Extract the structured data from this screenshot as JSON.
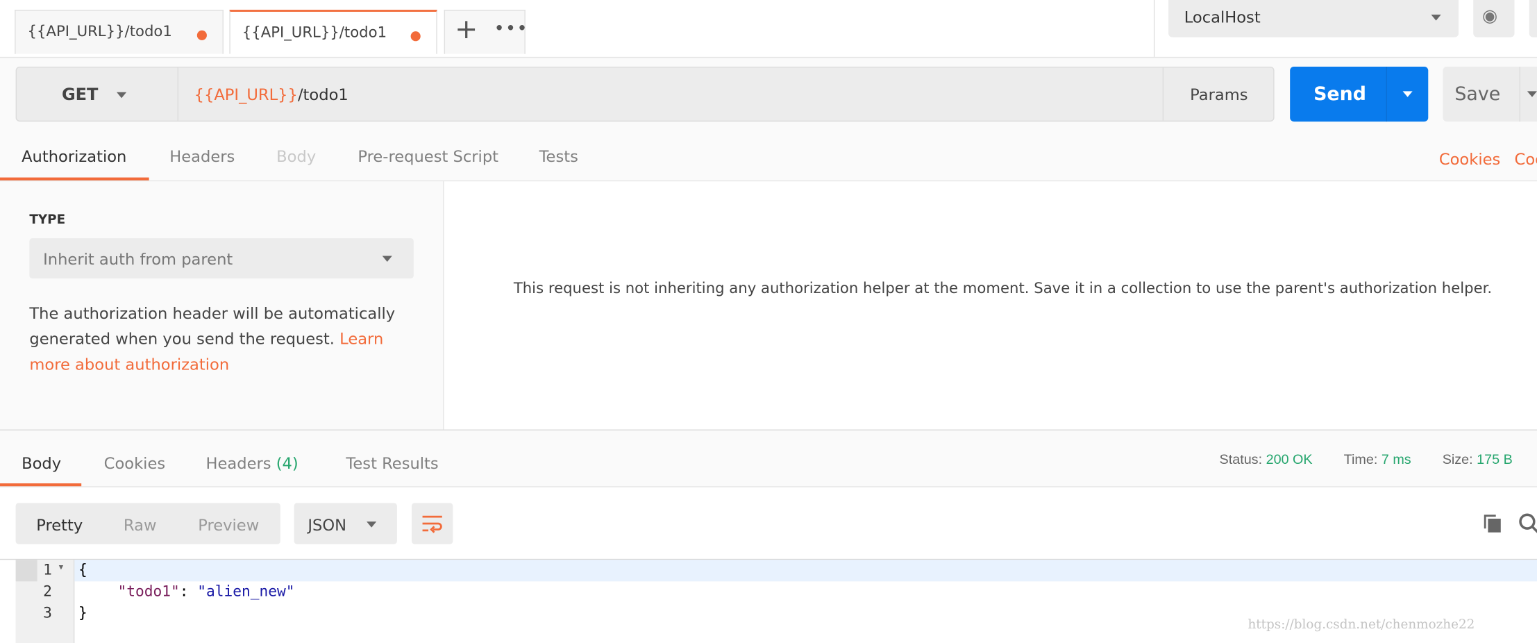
{
  "tabs": [
    {
      "label": "{{API_URL}}/todo1",
      "unsaved": true
    },
    {
      "label": "{{API_URL}}/todo1",
      "unsaved": true
    }
  ],
  "environment": {
    "selected": "LocalHost"
  },
  "request": {
    "method": "GET",
    "url_var": "{{API_URL}}",
    "url_path": "/todo1",
    "params_label": "Params",
    "send_label": "Send",
    "save_label": "Save"
  },
  "request_tabs": [
    "Authorization",
    "Headers",
    "Body",
    "Pre-request Script",
    "Tests"
  ],
  "request_links": {
    "cookies": "Cookies",
    "code": "Coc"
  },
  "auth": {
    "type_label": "TYPE",
    "type_value": "Inherit auth from parent",
    "description": "The authorization header will be automatically generated when you send the request. ",
    "learn_more": "Learn more about authorization",
    "message": "This request is not inheriting any authorization helper at the moment. Save it in a collection to use the parent's authorization helper."
  },
  "response_tabs": {
    "body": "Body",
    "cookies": "Cookies",
    "headers": "Headers",
    "headers_count": "(4)",
    "tests": "Test Results"
  },
  "status": {
    "status_label": "Status:",
    "status": "200 OK",
    "time_label": "Time:",
    "time": "7 ms",
    "size_label": "Size:",
    "size": "175 B"
  },
  "view_modes": [
    "Pretty",
    "Raw",
    "Preview"
  ],
  "format": "JSON",
  "code": {
    "lines": [
      "1",
      "2",
      "3"
    ],
    "open": "{",
    "key": "\"todo1\"",
    "colon": ": ",
    "value": "\"alien_new\"",
    "close": "}"
  },
  "watermark": "https://blog.csdn.net/chenmozhe22",
  "colors": {
    "accent": "#f26b3a",
    "send": "#097bed",
    "success": "#26a66e"
  }
}
